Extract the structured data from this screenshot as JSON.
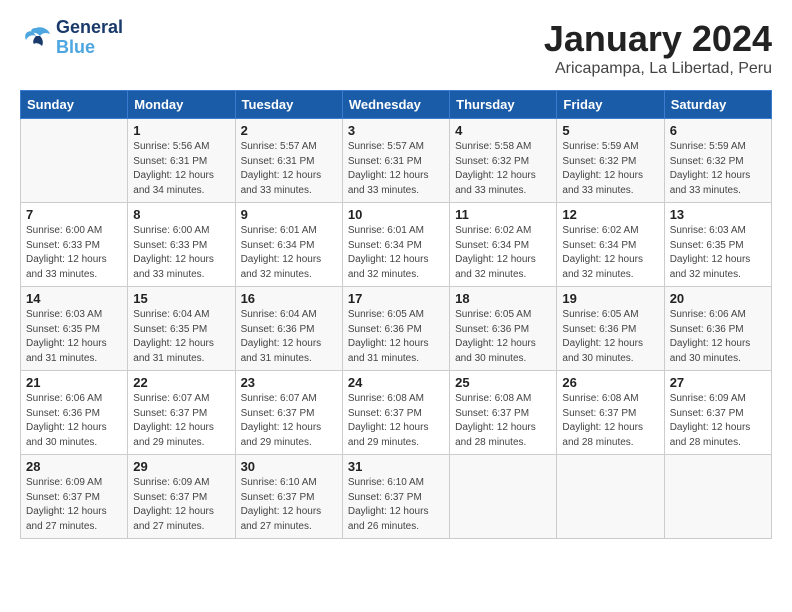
{
  "logo": {
    "line1": "General",
    "line2": "Blue"
  },
  "title": "January 2024",
  "subtitle": "Aricapampa, La Libertad, Peru",
  "headers": [
    "Sunday",
    "Monday",
    "Tuesday",
    "Wednesday",
    "Thursday",
    "Friday",
    "Saturday"
  ],
  "weeks": [
    [
      {
        "day": "",
        "info": ""
      },
      {
        "day": "1",
        "info": "Sunrise: 5:56 AM\nSunset: 6:31 PM\nDaylight: 12 hours\nand 34 minutes."
      },
      {
        "day": "2",
        "info": "Sunrise: 5:57 AM\nSunset: 6:31 PM\nDaylight: 12 hours\nand 33 minutes."
      },
      {
        "day": "3",
        "info": "Sunrise: 5:57 AM\nSunset: 6:31 PM\nDaylight: 12 hours\nand 33 minutes."
      },
      {
        "day": "4",
        "info": "Sunrise: 5:58 AM\nSunset: 6:32 PM\nDaylight: 12 hours\nand 33 minutes."
      },
      {
        "day": "5",
        "info": "Sunrise: 5:59 AM\nSunset: 6:32 PM\nDaylight: 12 hours\nand 33 minutes."
      },
      {
        "day": "6",
        "info": "Sunrise: 5:59 AM\nSunset: 6:32 PM\nDaylight: 12 hours\nand 33 minutes."
      }
    ],
    [
      {
        "day": "7",
        "info": "Sunrise: 6:00 AM\nSunset: 6:33 PM\nDaylight: 12 hours\nand 33 minutes."
      },
      {
        "day": "8",
        "info": "Sunrise: 6:00 AM\nSunset: 6:33 PM\nDaylight: 12 hours\nand 33 minutes."
      },
      {
        "day": "9",
        "info": "Sunrise: 6:01 AM\nSunset: 6:34 PM\nDaylight: 12 hours\nand 32 minutes."
      },
      {
        "day": "10",
        "info": "Sunrise: 6:01 AM\nSunset: 6:34 PM\nDaylight: 12 hours\nand 32 minutes."
      },
      {
        "day": "11",
        "info": "Sunrise: 6:02 AM\nSunset: 6:34 PM\nDaylight: 12 hours\nand 32 minutes."
      },
      {
        "day": "12",
        "info": "Sunrise: 6:02 AM\nSunset: 6:34 PM\nDaylight: 12 hours\nand 32 minutes."
      },
      {
        "day": "13",
        "info": "Sunrise: 6:03 AM\nSunset: 6:35 PM\nDaylight: 12 hours\nand 32 minutes."
      }
    ],
    [
      {
        "day": "14",
        "info": "Sunrise: 6:03 AM\nSunset: 6:35 PM\nDaylight: 12 hours\nand 31 minutes."
      },
      {
        "day": "15",
        "info": "Sunrise: 6:04 AM\nSunset: 6:35 PM\nDaylight: 12 hours\nand 31 minutes."
      },
      {
        "day": "16",
        "info": "Sunrise: 6:04 AM\nSunset: 6:36 PM\nDaylight: 12 hours\nand 31 minutes."
      },
      {
        "day": "17",
        "info": "Sunrise: 6:05 AM\nSunset: 6:36 PM\nDaylight: 12 hours\nand 31 minutes."
      },
      {
        "day": "18",
        "info": "Sunrise: 6:05 AM\nSunset: 6:36 PM\nDaylight: 12 hours\nand 30 minutes."
      },
      {
        "day": "19",
        "info": "Sunrise: 6:05 AM\nSunset: 6:36 PM\nDaylight: 12 hours\nand 30 minutes."
      },
      {
        "day": "20",
        "info": "Sunrise: 6:06 AM\nSunset: 6:36 PM\nDaylight: 12 hours\nand 30 minutes."
      }
    ],
    [
      {
        "day": "21",
        "info": "Sunrise: 6:06 AM\nSunset: 6:36 PM\nDaylight: 12 hours\nand 30 minutes."
      },
      {
        "day": "22",
        "info": "Sunrise: 6:07 AM\nSunset: 6:37 PM\nDaylight: 12 hours\nand 29 minutes."
      },
      {
        "day": "23",
        "info": "Sunrise: 6:07 AM\nSunset: 6:37 PM\nDaylight: 12 hours\nand 29 minutes."
      },
      {
        "day": "24",
        "info": "Sunrise: 6:08 AM\nSunset: 6:37 PM\nDaylight: 12 hours\nand 29 minutes."
      },
      {
        "day": "25",
        "info": "Sunrise: 6:08 AM\nSunset: 6:37 PM\nDaylight: 12 hours\nand 28 minutes."
      },
      {
        "day": "26",
        "info": "Sunrise: 6:08 AM\nSunset: 6:37 PM\nDaylight: 12 hours\nand 28 minutes."
      },
      {
        "day": "27",
        "info": "Sunrise: 6:09 AM\nSunset: 6:37 PM\nDaylight: 12 hours\nand 28 minutes."
      }
    ],
    [
      {
        "day": "28",
        "info": "Sunrise: 6:09 AM\nSunset: 6:37 PM\nDaylight: 12 hours\nand 27 minutes."
      },
      {
        "day": "29",
        "info": "Sunrise: 6:09 AM\nSunset: 6:37 PM\nDaylight: 12 hours\nand 27 minutes."
      },
      {
        "day": "30",
        "info": "Sunrise: 6:10 AM\nSunset: 6:37 PM\nDaylight: 12 hours\nand 27 minutes."
      },
      {
        "day": "31",
        "info": "Sunrise: 6:10 AM\nSunset: 6:37 PM\nDaylight: 12 hours\nand 26 minutes."
      },
      {
        "day": "",
        "info": ""
      },
      {
        "day": "",
        "info": ""
      },
      {
        "day": "",
        "info": ""
      }
    ]
  ]
}
